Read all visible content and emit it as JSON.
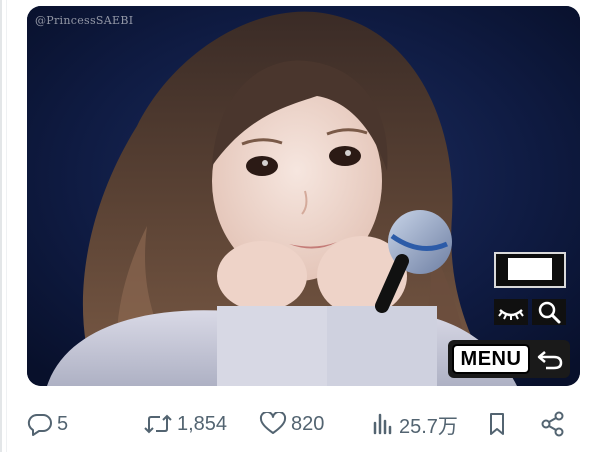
{
  "media": {
    "watermark": "@PrincessSAEBI",
    "overlay": {
      "menu_label": "MENU",
      "icons": [
        "frame-icon",
        "eye-icon",
        "magnifier-icon",
        "back-arrow-icon"
      ]
    },
    "colors": {
      "background": "#0f1b42",
      "button_dark": "#101010",
      "button_light": "#ffffff"
    }
  },
  "actions": {
    "reply": {
      "icon": "reply-bubble-icon",
      "count": "5"
    },
    "retweet": {
      "icon": "retweet-icon",
      "count": "1,854"
    },
    "like": {
      "icon": "heart-icon",
      "count": "820"
    },
    "views": {
      "icon": "bar-chart-icon",
      "count": "25.7万"
    },
    "bookmark": {
      "icon": "bookmark-icon"
    },
    "share": {
      "icon": "share-icon"
    },
    "color": "#536471"
  }
}
